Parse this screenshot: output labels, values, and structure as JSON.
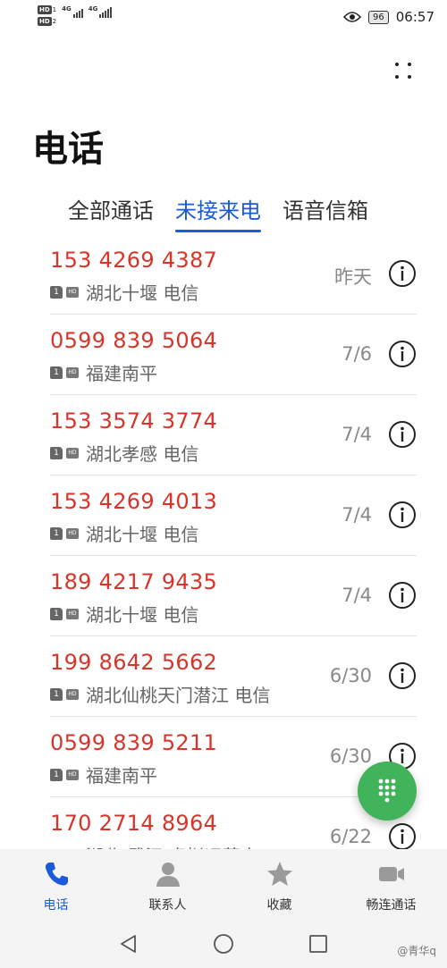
{
  "status_bar": {
    "sim1_tag": "HD",
    "sim1_index": "1",
    "sim2_tag": "HD",
    "sim2_index": "2",
    "net1": "4G",
    "net2": "4G",
    "battery": "96",
    "time": "06:57"
  },
  "header": {
    "title": "电话",
    "more_icon": "more-dots-icon"
  },
  "tabs": [
    {
      "label": "全部通话",
      "active": false
    },
    {
      "label": "未接来电",
      "active": true
    },
    {
      "label": "语音信箱",
      "active": false
    }
  ],
  "calls": [
    {
      "number": "153 4269 4387",
      "sim": "1",
      "hd": "HD",
      "location": "湖北十堰 电信",
      "date": "昨天"
    },
    {
      "number": "0599 839 5064",
      "sim": "1",
      "hd": "HD",
      "location": "福建南平",
      "date": "7/6"
    },
    {
      "number": "153 3574 3774",
      "sim": "1",
      "hd": "HD",
      "location": "湖北孝感 电信",
      "date": "7/4"
    },
    {
      "number": "153 4269 4013",
      "sim": "1",
      "hd": "HD",
      "location": "湖北十堰 电信",
      "date": "7/4"
    },
    {
      "number": "189 4217 9435",
      "sim": "1",
      "hd": "HD",
      "location": "湖北十堰 电信",
      "date": "7/4"
    },
    {
      "number": "199 8642 5662",
      "sim": "1",
      "hd": "HD",
      "location": "湖北仙桃天门潜江 电信",
      "date": "6/30"
    },
    {
      "number": "0599 839 5211",
      "sim": "1",
      "hd": "HD",
      "location": "福建南平",
      "date": "6/30"
    },
    {
      "number": "170 2714 8964",
      "sim": "1",
      "hd": "HD",
      "location": "湖北 武汉 虚拟运营商",
      "date": "6/22"
    }
  ],
  "bottom_nav": [
    {
      "label": "电话",
      "icon": "phone-icon",
      "active": true
    },
    {
      "label": "联系人",
      "icon": "contacts-icon",
      "active": false
    },
    {
      "label": "收藏",
      "icon": "star-icon",
      "active": false
    },
    {
      "label": "畅连通话",
      "icon": "video-call-icon",
      "active": false
    }
  ],
  "fab_icon": "dialpad-icon",
  "watermark": "@青华q",
  "colors": {
    "accent": "#1a5bdb",
    "missed_call": "#d8352a",
    "fab": "#41b35a"
  }
}
